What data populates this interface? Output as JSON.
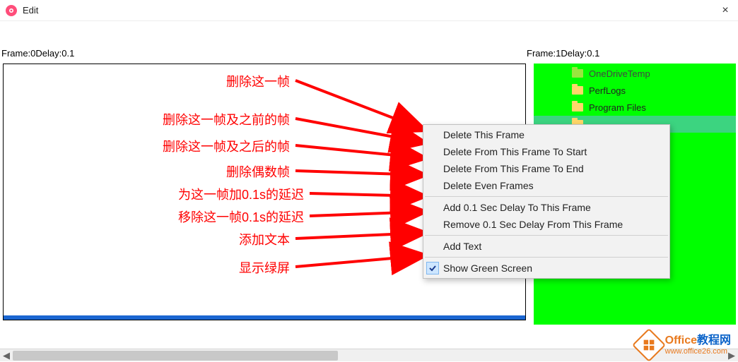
{
  "window": {
    "title": "Edit",
    "close": "×"
  },
  "frames": {
    "label0": "Frame:0Delay:0.1",
    "label1": "Frame:1Delay:0.1"
  },
  "folders": [
    {
      "name": "OneDriveTemp",
      "cut": true
    },
    {
      "name": "PerfLogs",
      "cut": false
    },
    {
      "name": "Program Files",
      "cut": false
    },
    {
      "name": "",
      "cut": false,
      "selected": true
    }
  ],
  "annotations": [
    {
      "text": "删除这一帧"
    },
    {
      "text": "删除这一帧及之前的帧"
    },
    {
      "text": "删除这一帧及之后的帧"
    },
    {
      "text": "删除偶数帧"
    },
    {
      "text": "为这一帧加0.1s的延迟"
    },
    {
      "text": "移除这一帧0.1s的延迟"
    },
    {
      "text": "添加文本"
    },
    {
      "text": "显示绿屏"
    }
  ],
  "menu": {
    "items": [
      "Delete This Frame",
      "Delete From This Frame To Start",
      "Delete From This Frame To End",
      "Delete Even Frames"
    ],
    "items2": [
      "Add 0.1 Sec Delay To This Frame",
      "Remove 0.1 Sec Delay From This Frame"
    ],
    "items3": [
      "Add Text"
    ],
    "items4": [
      "Show Green Screen"
    ]
  },
  "watermark": {
    "line1a": "Office",
    "line1b": "教程网",
    "line2": "www.office26.com"
  }
}
